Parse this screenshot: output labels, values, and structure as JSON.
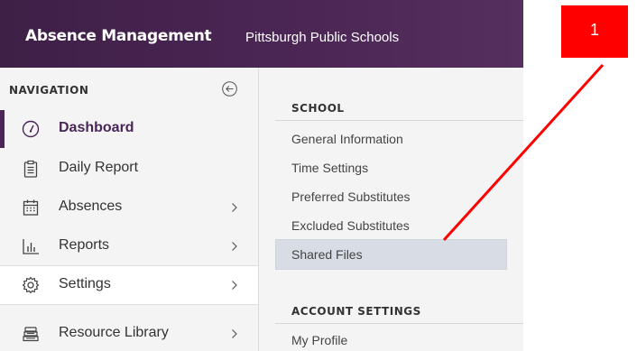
{
  "header": {
    "app_title": "Absence Management",
    "organization": "Pittsburgh Public Schools"
  },
  "nav": {
    "heading": "NAVIGATION",
    "items": [
      {
        "label": "Dashboard",
        "icon": "dashboard-gauge-icon",
        "active": true
      },
      {
        "label": "Daily Report",
        "icon": "clipboard-icon"
      },
      {
        "label": "Absences",
        "icon": "calendar-icon",
        "has_submenu": true
      },
      {
        "label": "Reports",
        "icon": "bar-chart-icon",
        "has_submenu": true
      },
      {
        "label": "Settings",
        "icon": "gear-icon",
        "has_submenu": true,
        "expanded": true
      },
      {
        "label": "Resource Library",
        "icon": "books-icon",
        "has_submenu": true
      }
    ]
  },
  "settings_panel": {
    "school_heading": "SCHOOL",
    "school_items": [
      "General Information",
      "Time Settings",
      "Preferred Substitutes",
      "Excluded Substitutes",
      "Shared Files"
    ],
    "selected_item": "Shared Files",
    "account_heading": "ACCOUNT SETTINGS",
    "account_items": [
      "My Profile"
    ]
  },
  "annotation": {
    "callout_number": "1",
    "color": "#ff0000"
  },
  "colors": {
    "brand_purple": "#4a2656",
    "highlight": "#d8dde5"
  }
}
